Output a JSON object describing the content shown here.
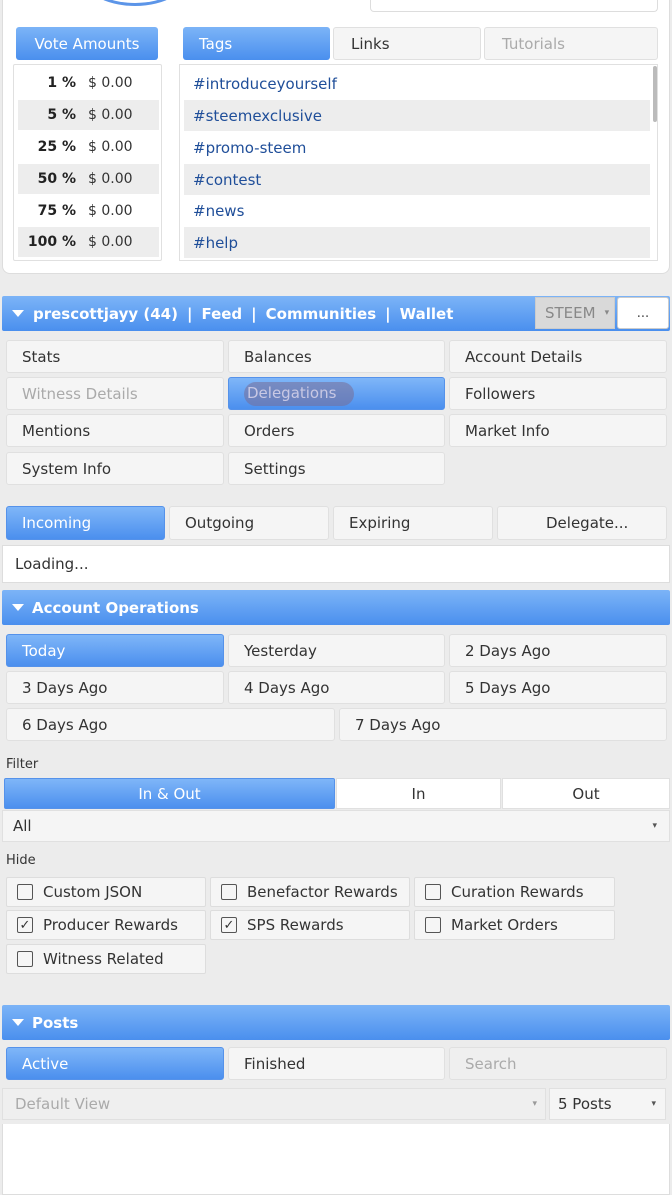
{
  "vote": {
    "header": "Vote Amounts",
    "rows": [
      {
        "pct": "1 %",
        "val": "$ 0.00"
      },
      {
        "pct": "5 %",
        "val": "$ 0.00"
      },
      {
        "pct": "25 %",
        "val": "$ 0.00"
      },
      {
        "pct": "50 %",
        "val": "$ 0.00"
      },
      {
        "pct": "75 %",
        "val": "$ 0.00"
      },
      {
        "pct": "100 %",
        "val": "$ 0.00"
      }
    ]
  },
  "tabs_top": {
    "tags": "Tags",
    "links": "Links",
    "tutorials": "Tutorials"
  },
  "tags": [
    "#introduceyourself",
    "#steemexclusive",
    "#promo-steem",
    "#contest",
    "#news",
    "#help"
  ],
  "userbar": {
    "user": "prescottjayy (44)",
    "sep": "|",
    "feed": "Feed",
    "communities": "Communities",
    "wallet": "Wallet",
    "currency": "STEEM",
    "more": "..."
  },
  "menu": {
    "stats": "Stats",
    "balances": "Balances",
    "account_details": "Account Details",
    "witness_details": "Witness Details",
    "delegations": "Delegations",
    "followers": "Followers",
    "mentions": "Mentions",
    "orders": "Orders",
    "market_info": "Market Info",
    "system_info": "System Info",
    "settings": "Settings"
  },
  "delegation_tabs": {
    "incoming": "Incoming",
    "outgoing": "Outgoing",
    "expiring": "Expiring",
    "delegate": "Delegate..."
  },
  "loading": "Loading...",
  "account_ops": {
    "title": "Account Operations",
    "days": [
      "Today",
      "Yesterday",
      "2 Days Ago",
      "3 Days Ago",
      "4 Days Ago",
      "5 Days Ago",
      "6 Days Ago",
      "7 Days Ago"
    ],
    "filter_label": "Filter",
    "filter_tabs": [
      "In & Out",
      "In",
      "Out"
    ],
    "filter_select": "All",
    "hide_label": "Hide",
    "hide_items": [
      {
        "label": "Custom JSON",
        "checked": false
      },
      {
        "label": "Benefactor Rewards",
        "checked": false
      },
      {
        "label": "Curation Rewards",
        "checked": false
      },
      {
        "label": "Producer Rewards",
        "checked": true
      },
      {
        "label": "SPS Rewards",
        "checked": true
      },
      {
        "label": "Market Orders",
        "checked": false
      },
      {
        "label": "Witness Related",
        "checked": false
      }
    ]
  },
  "posts": {
    "title": "Posts",
    "active": "Active",
    "finished": "Finished",
    "search_placeholder": "Search",
    "view_select": "Default View",
    "count_select": "5 Posts"
  },
  "colors": {
    "accent": "#4a8fee",
    "tag_link": "#1f4e99"
  }
}
